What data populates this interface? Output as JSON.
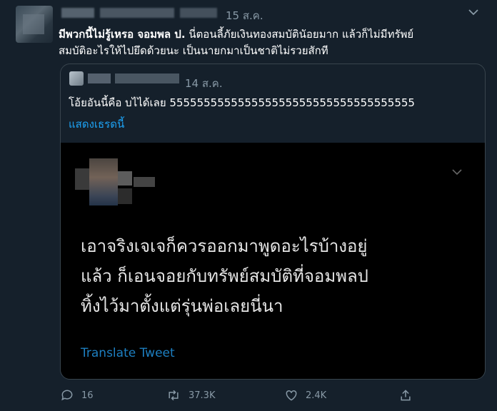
{
  "tweet": {
    "date": "15 ส.ค.",
    "text_line1_bold": "มีพวกนี้ไม่รู้เหรอ จอมพล ป.",
    "text_line1_rest": " นี่ตอนลี้ภัยเงินทองสมบัตินัอยมาก แล้วก็ไม่มีทรัพย์",
    "text_line2": "สมบัติอะไรให้ไปยึดด้วยนะ เป็นนายกมาเป็นชาติไม่รวยสักที"
  },
  "quote": {
    "date": "14 ส.ค.",
    "text": "โอ้ยอันนี้คือ บไได้เลย 555555555555555555555555555555555555",
    "show_thread": "แสดงเธรดนี้"
  },
  "embedded": {
    "line1": "เอาจริงเจเจก็ควรออกมาพูดอะไรบ้างอยู่",
    "line2": "แล้ว ก็เอนจอยกับทรัพย์สมบัติที่จอมพลป",
    "line3": "ทิ้งไว้มาตั้งแต่รุ่นพ่อเลยนี่นา",
    "translate": "Translate Tweet"
  },
  "actions": {
    "replies": "16",
    "retweets": "37.3K",
    "likes": "2.4K"
  },
  "colors": {
    "background": "#15202b",
    "accent": "#1da1f2",
    "muted": "#8899a6"
  },
  "icons": [
    "reply-icon",
    "retweet-icon",
    "like-icon",
    "share-icon",
    "chevron-down-icon"
  ]
}
